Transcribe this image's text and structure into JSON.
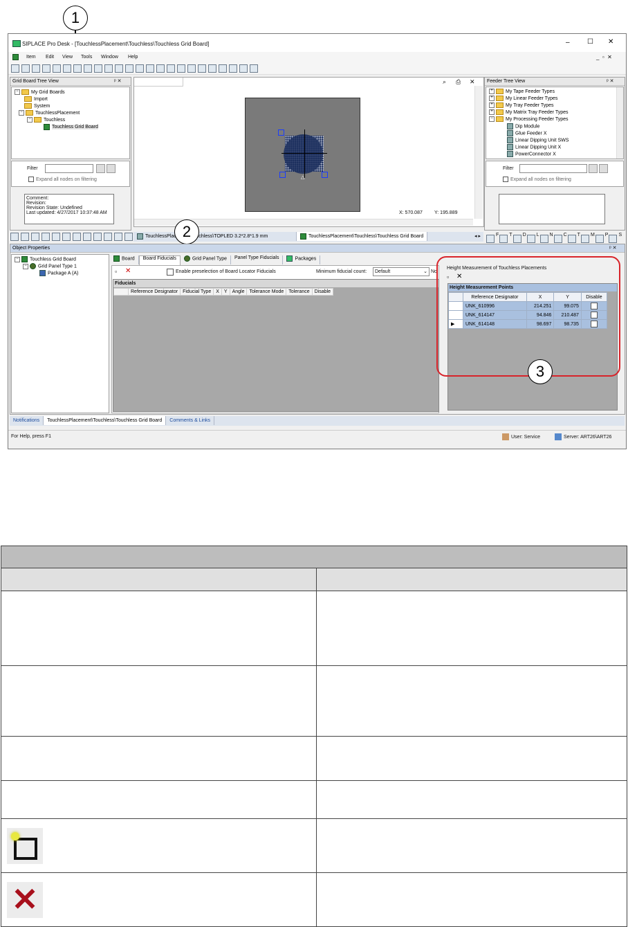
{
  "callouts": [
    "1",
    "2",
    "3"
  ],
  "window": {
    "title": "SIPLACE Pro Desk - [TouchlessPlacement\\Touchless\\Touchless Grid Board]",
    "controls": {
      "minimize": "–",
      "maximize": "☐",
      "close": "✕"
    }
  },
  "menu": [
    "Item",
    "Edit",
    "View",
    "Tools",
    "Window",
    "Help"
  ],
  "grid_board_tree": {
    "title": "Grid Board Tree View",
    "items": [
      "My Grid Boards",
      "Import",
      "System",
      "TouchlessPlacement",
      "Touchless",
      "Touchless Grid Board"
    ],
    "filter_label": "Filter",
    "expand_label": "Expand all nodes on filtering",
    "comment": [
      "Comment:",
      "Revision:",
      "Revision State: Undefined",
      "Last updated: 4/27/2017 10:37:48 AM"
    ]
  },
  "center": {
    "coord_x": "X:  570.087",
    "coord_y": "Y:  195.889",
    "doc_tabs": [
      "TouchlessPlacement\\Touchless\\TOPLED 3.2*2.8*1.9 mm",
      "TouchlessPlacement\\Touchless\\Touchless Grid Board"
    ]
  },
  "feeder_tree": {
    "title": "Feeder Tree View",
    "items": [
      "My Tape Feeder Types",
      "My Linear Feeder Types",
      "My Tray Feeder Types",
      "My Matrix Tray Feeder Types",
      "My Processing Feeder Types",
      "Dip Module",
      "Glue Feeder X",
      "Linear Dipping Unit SWS",
      "Linear Dipping Unit X",
      "PowerConnector X"
    ],
    "filter_label": "Filter",
    "expand_label": "Expand all nodes on filtering",
    "bottom_tabs": [
      "F",
      "T",
      "D",
      "L",
      "N",
      "C",
      "T",
      "M",
      "P",
      "S"
    ]
  },
  "object_properties": {
    "title": "Object Properties",
    "tree": [
      "Touchless Grid Board",
      "Grid Panel Type 1",
      "Package  A (A)"
    ],
    "tabs": [
      "Board",
      "Board Fiducials",
      "Grid Panel Type",
      "Panel Type Fiducials",
      "Packages"
    ],
    "enable_preselection": "Enable preselection of Board Locator Fiducials",
    "min_fiducial_label": "Minimum fiducial count:",
    "min_fiducial_value": "Default",
    "no_label": "No",
    "fiducials_header": "Fiducials",
    "fiducial_columns": [
      "Reference Designator",
      "Fiducial Type",
      "X",
      "Y",
      "Angle",
      "Tolerance Mode",
      "Tolerance",
      "Disable"
    ],
    "height_measurement": {
      "title": "Height Measurement of Touchless Placements",
      "header": "Height Measurement Points",
      "columns": [
        "Reference Designator",
        "X",
        "Y",
        "Disable"
      ],
      "rows": [
        {
          "ref": "UNK_610996",
          "x": "214.251",
          "y": "99.075"
        },
        {
          "ref": "UNK_614147",
          "x": "94.846",
          "y": "210.487"
        },
        {
          "ref": "UNK_614148",
          "x": "98.697",
          "y": "98.735"
        }
      ]
    }
  },
  "bottom_tabs": [
    "Notifications",
    "TouchlessPlacement\\Touchless\\Touchless Grid Board",
    "Comments & Links"
  ],
  "status": {
    "help": "For Help, press F1",
    "user": "User:  Service",
    "server": "Server:  ART26\\ART26"
  },
  "colors": {
    "accent": "#d8232a",
    "canvas_gray": "#7a7a7a",
    "board_dark": "#1c2f5e",
    "selection": "#a9c0df"
  }
}
